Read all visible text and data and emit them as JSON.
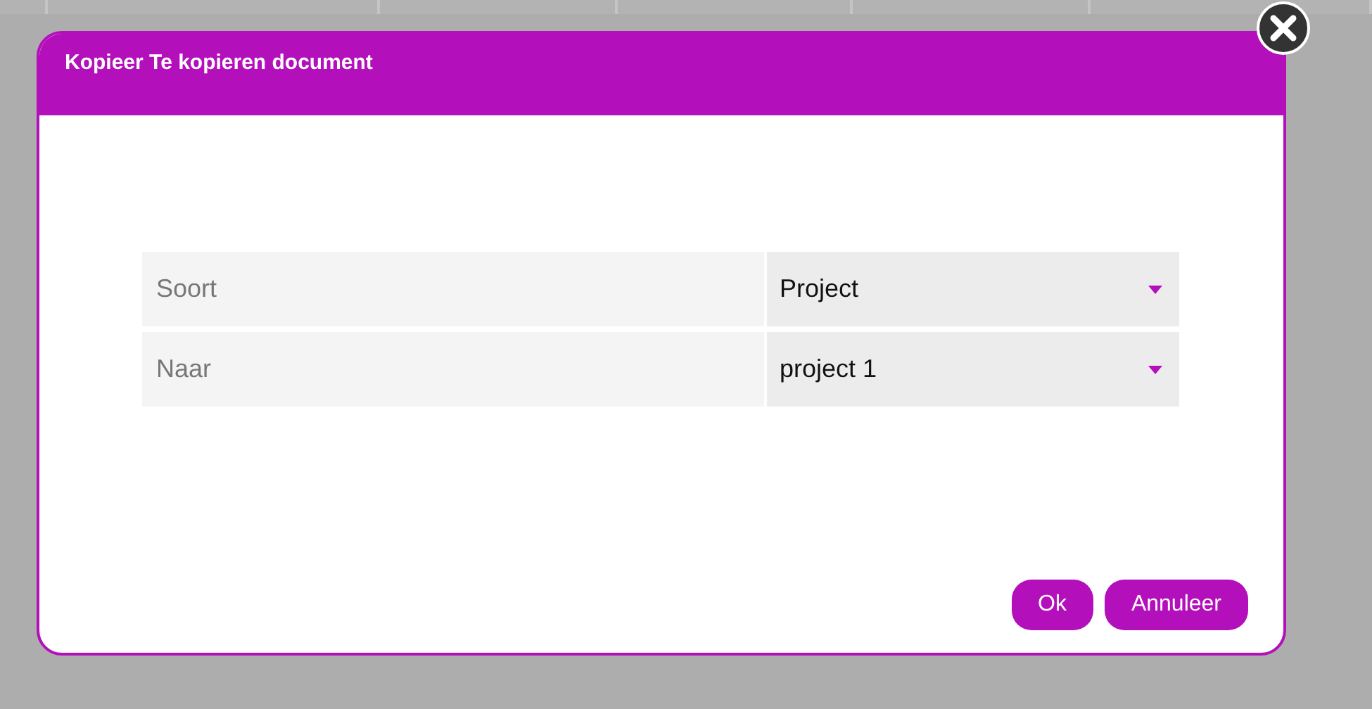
{
  "dialog": {
    "title": "Kopieer Te kopieren document",
    "fields": [
      {
        "label": "Soort",
        "value": "Project"
      },
      {
        "label": "Naar",
        "value": "project 1"
      }
    ],
    "buttons": [
      {
        "label": "Ok"
      },
      {
        "label": "Annuleer"
      }
    ]
  }
}
